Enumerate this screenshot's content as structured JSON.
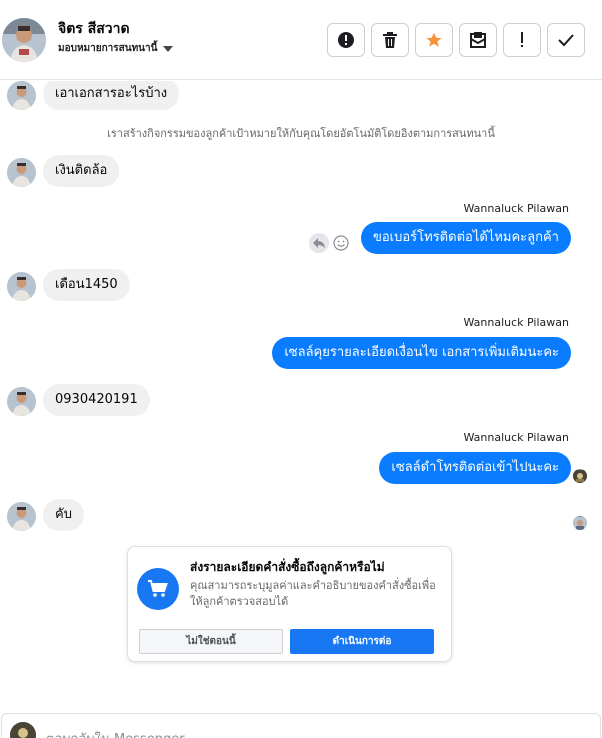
{
  "header": {
    "contact_name": "จิตร สีสวาด",
    "assign_label": "มอบหมายการสนทนานี้",
    "actions": [
      {
        "name": "spam-button",
        "icon": "alert-circle-icon"
      },
      {
        "name": "delete-button",
        "icon": "trash-icon"
      },
      {
        "name": "star-button",
        "icon": "star-icon"
      },
      {
        "name": "mark-unread-button",
        "icon": "mail-icon"
      },
      {
        "name": "follow-up-button",
        "icon": "exclamation-icon"
      },
      {
        "name": "done-button",
        "icon": "check-icon"
      }
    ]
  },
  "messages": {
    "m1": "เอาเอกสารอะไรบ้าง",
    "system_note": "เราสร้างกิจกรรมของลูกค้าเป้าหมายให้กับคุณโดยอัตโนมัติโดยอิงตามการสนทนานี้",
    "m2": "เงินติดล้อ",
    "sender1": "Wannaluck Pilawan",
    "m3": "ขอเบอร์โทรติดต่อได้ไหมคะลูกค้า",
    "m4": "เดือน1450",
    "sender2": "Wannaluck Pilawan",
    "m5": "เซลล์คุยรายละเอียดเงื่อนไข เอกสารเพิ่มเติมนะคะ",
    "m6": "0930420191",
    "sender3": "Wannaluck Pilawan",
    "m7": "เซลล์ดำโทรติดต่อเข้าไปนะคะ",
    "m8": "คับ"
  },
  "card": {
    "title": "ส่งรายละเอียดคำสั่งซื้อถึงลูกค้าหรือไม่",
    "description": "คุณสามารถระบุมูลค่าและคำอธิบายของคำสั่งซื้อเพื่อให้ลูกค้าตรวจสอบได้",
    "skip_label": "ไม่ใช่ตอนนี้",
    "continue_label": "ดำเนินการต่อ",
    "icon": "shopping-cart-icon"
  },
  "composer": {
    "placeholder": "ตอบกลับใน Messenger"
  },
  "colors": {
    "outgoing_bubble": "#0a7cff",
    "incoming_bubble": "#f0f0f0",
    "primary_button": "#1877f2",
    "star": "#f7923a"
  }
}
